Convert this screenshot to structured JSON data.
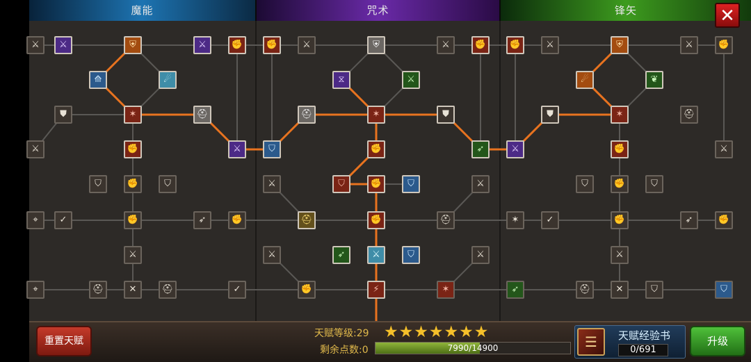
{
  "tabs": {
    "magic": "魔能",
    "curse": "咒术",
    "arrow": "锋矢"
  },
  "close_icon": "✕",
  "colors": {
    "active_link": "#e8731f",
    "inactive_link": "#5a5855",
    "panel_bg": "#2d2a27"
  },
  "grid": {
    "cols": [
      51,
      91,
      141,
      191,
      241,
      291,
      341,
      391,
      441,
      491,
      541,
      591,
      641,
      691,
      741,
      791,
      841,
      891,
      941,
      991,
      1041
    ],
    "rows": [
      65,
      115,
      165,
      215,
      265,
      317,
      367,
      417
    ]
  },
  "nodes": [
    {
      "c": 0,
      "r": 0,
      "g": "⚔",
      "t": "",
      "on": false
    },
    {
      "c": 1,
      "r": 0,
      "g": "⚔",
      "t": "purple",
      "on": true
    },
    {
      "c": 3,
      "r": 0,
      "g": "⛨",
      "t": "orange",
      "on": true
    },
    {
      "c": 5,
      "r": 0,
      "g": "⚔",
      "t": "purple",
      "on": true
    },
    {
      "c": 6,
      "r": 0,
      "g": "✊",
      "t": "red",
      "on": true
    },
    {
      "c": 7,
      "r": 0,
      "g": "✊",
      "t": "red",
      "on": true
    },
    {
      "c": 8,
      "r": 0,
      "g": "⚔",
      "t": "",
      "on": false
    },
    {
      "c": 10,
      "r": 0,
      "g": "⛨",
      "t": "gray",
      "on": true
    },
    {
      "c": 12,
      "r": 0,
      "g": "⚔",
      "t": "",
      "on": false
    },
    {
      "c": 13,
      "r": 0,
      "g": "✊",
      "t": "red",
      "on": true
    },
    {
      "c": 14,
      "r": 0,
      "g": "✊",
      "t": "red",
      "on": true
    },
    {
      "c": 15,
      "r": 0,
      "g": "⚔",
      "t": "",
      "on": false
    },
    {
      "c": 17,
      "r": 0,
      "g": "⛨",
      "t": "orange",
      "on": true
    },
    {
      "c": 19,
      "r": 0,
      "g": "⚔",
      "t": "",
      "on": false
    },
    {
      "c": 20,
      "r": 0,
      "g": "✊",
      "t": "",
      "on": false
    },
    {
      "c": 2,
      "r": 1,
      "g": "⟰",
      "t": "blue",
      "on": true
    },
    {
      "c": 4,
      "r": 1,
      "g": "☄",
      "t": "cyan",
      "on": true
    },
    {
      "c": 9,
      "r": 1,
      "g": "⧖",
      "t": "purple",
      "on": true
    },
    {
      "c": 11,
      "r": 1,
      "g": "⚔",
      "t": "green",
      "on": true
    },
    {
      "c": 16,
      "r": 1,
      "g": "☄",
      "t": "orange",
      "on": true
    },
    {
      "c": 18,
      "r": 1,
      "g": "❦",
      "t": "green",
      "on": true
    },
    {
      "c": 1,
      "r": 2,
      "g": "⛊",
      "t": "",
      "on": false
    },
    {
      "c": 3,
      "r": 2,
      "g": "✶",
      "t": "red",
      "on": true
    },
    {
      "c": 5,
      "r": 2,
      "g": "⛑",
      "t": "gray",
      "on": true
    },
    {
      "c": 8,
      "r": 2,
      "g": "⛑",
      "t": "gray",
      "on": true
    },
    {
      "c": 10,
      "r": 2,
      "g": "✶",
      "t": "red",
      "on": true
    },
    {
      "c": 12,
      "r": 2,
      "g": "⛊",
      "t": "",
      "on": true
    },
    {
      "c": 15,
      "r": 2,
      "g": "⛊",
      "t": "",
      "on": true
    },
    {
      "c": 17,
      "r": 2,
      "g": "✶",
      "t": "red",
      "on": true
    },
    {
      "c": 19,
      "r": 2,
      "g": "⛑",
      "t": "",
      "on": false
    },
    {
      "c": 0,
      "r": 3,
      "g": "⚔",
      "t": "",
      "on": false
    },
    {
      "c": 3,
      "r": 3,
      "g": "✊",
      "t": "red",
      "on": true
    },
    {
      "c": 6,
      "r": 3,
      "g": "⚔",
      "t": "purple",
      "on": true
    },
    {
      "c": 7,
      "r": 3,
      "g": "⛉",
      "t": "blue",
      "on": true
    },
    {
      "c": 10,
      "r": 3,
      "g": "✊",
      "t": "red",
      "on": true
    },
    {
      "c": 13,
      "r": 3,
      "g": "➶",
      "t": "green",
      "on": true
    },
    {
      "c": 14,
      "r": 3,
      "g": "⚔",
      "t": "purple",
      "on": true
    },
    {
      "c": 17,
      "r": 3,
      "g": "✊",
      "t": "red",
      "on": true
    },
    {
      "c": 20,
      "r": 3,
      "g": "⚔",
      "t": "",
      "on": false
    },
    {
      "c": 2,
      "r": 4,
      "g": "⛉",
      "t": "",
      "on": false
    },
    {
      "c": 3,
      "r": 4,
      "g": "✊",
      "t": "",
      "on": false
    },
    {
      "c": 4,
      "r": 4,
      "g": "⛉",
      "t": "",
      "on": false
    },
    {
      "c": 7,
      "r": 4,
      "g": "⚔",
      "t": "",
      "on": false
    },
    {
      "c": 9,
      "r": 4,
      "g": "⛉",
      "t": "red",
      "on": true
    },
    {
      "c": 10,
      "r": 4,
      "g": "✊",
      "t": "red",
      "on": true
    },
    {
      "c": 11,
      "r": 4,
      "g": "⛉",
      "t": "blue",
      "on": true
    },
    {
      "c": 13,
      "r": 4,
      "g": "⚔",
      "t": "",
      "on": false
    },
    {
      "c": 16,
      "r": 4,
      "g": "⛉",
      "t": "",
      "on": false
    },
    {
      "c": 17,
      "r": 4,
      "g": "✊",
      "t": "",
      "on": false
    },
    {
      "c": 18,
      "r": 4,
      "g": "⛉",
      "t": "",
      "on": false
    },
    {
      "c": 0,
      "r": 5,
      "g": "⌖",
      "t": "",
      "on": false
    },
    {
      "c": 1,
      "r": 5,
      "g": "✓",
      "t": "",
      "on": false
    },
    {
      "c": 3,
      "r": 5,
      "g": "✊",
      "t": "",
      "on": false
    },
    {
      "c": 5,
      "r": 5,
      "g": "➶",
      "t": "",
      "on": false
    },
    {
      "c": 6,
      "r": 5,
      "g": "✊",
      "t": "",
      "on": false
    },
    {
      "c": 8,
      "r": 5,
      "g": "⛑",
      "t": "gold",
      "on": true
    },
    {
      "c": 10,
      "r": 5,
      "g": "✊",
      "t": "red",
      "on": true
    },
    {
      "c": 12,
      "r": 5,
      "g": "⛑",
      "t": "",
      "on": false
    },
    {
      "c": 14,
      "r": 5,
      "g": "✶",
      "t": "",
      "on": false
    },
    {
      "c": 15,
      "r": 5,
      "g": "✓",
      "t": "",
      "on": false
    },
    {
      "c": 17,
      "r": 5,
      "g": "✊",
      "t": "",
      "on": false
    },
    {
      "c": 19,
      "r": 5,
      "g": "➶",
      "t": "",
      "on": false
    },
    {
      "c": 20,
      "r": 5,
      "g": "✊",
      "t": "",
      "on": false
    },
    {
      "c": 3,
      "r": 6,
      "g": "⚔",
      "t": "",
      "on": false
    },
    {
      "c": 7,
      "r": 6,
      "g": "⚔",
      "t": "",
      "on": false
    },
    {
      "c": 9,
      "r": 6,
      "g": "➶",
      "t": "green",
      "on": true
    },
    {
      "c": 10,
      "r": 6,
      "g": "⚔",
      "t": "cyan",
      "on": true
    },
    {
      "c": 11,
      "r": 6,
      "g": "⛉",
      "t": "blue",
      "on": true
    },
    {
      "c": 13,
      "r": 6,
      "g": "⚔",
      "t": "",
      "on": false
    },
    {
      "c": 17,
      "r": 6,
      "g": "⚔",
      "t": "",
      "on": false
    },
    {
      "c": 0,
      "r": 7,
      "g": "⌖",
      "t": "",
      "on": false
    },
    {
      "c": 2,
      "r": 7,
      "g": "⛑",
      "t": "",
      "on": false
    },
    {
      "c": 3,
      "r": 7,
      "g": "✕",
      "t": "",
      "on": false
    },
    {
      "c": 4,
      "r": 7,
      "g": "⛑",
      "t": "",
      "on": false
    },
    {
      "c": 6,
      "r": 7,
      "g": "✓",
      "t": "",
      "on": false
    },
    {
      "c": 8,
      "r": 7,
      "g": "✊",
      "t": "",
      "on": false
    },
    {
      "c": 10,
      "r": 7,
      "g": "⚡",
      "t": "red",
      "on": true
    },
    {
      "c": 12,
      "r": 7,
      "g": "✶",
      "t": "red",
      "on": false
    },
    {
      "c": 14,
      "r": 7,
      "g": "➶",
      "t": "green",
      "on": false
    },
    {
      "c": 16,
      "r": 7,
      "g": "⛑",
      "t": "",
      "on": false
    },
    {
      "c": 17,
      "r": 7,
      "g": "✕",
      "t": "",
      "on": false
    },
    {
      "c": 18,
      "r": 7,
      "g": "⛉",
      "t": "",
      "on": false
    },
    {
      "c": 20,
      "r": 7,
      "g": "⛉",
      "t": "blue",
      "on": false
    }
  ],
  "links": [
    {
      "a": [
        3,
        0
      ],
      "b": [
        2,
        1
      ],
      "on": true
    },
    {
      "a": [
        3,
        0
      ],
      "b": [
        4,
        1
      ],
      "on": false
    },
    {
      "a": [
        2,
        1
      ],
      "b": [
        3,
        2
      ],
      "on": true
    },
    {
      "a": [
        4,
        1
      ],
      "b": [
        3,
        2
      ],
      "on": false
    },
    {
      "a": [
        3,
        2
      ],
      "b": [
        5,
        2
      ],
      "on": true
    },
    {
      "a": [
        5,
        2
      ],
      "b": [
        6,
        3
      ],
      "on": true
    },
    {
      "a": [
        1,
        2
      ],
      "b": [
        3,
        2
      ],
      "on": false
    },
    {
      "a": [
        3,
        2
      ],
      "b": [
        3,
        3
      ],
      "on": false
    },
    {
      "a": [
        6,
        3
      ],
      "b": [
        7,
        3
      ],
      "on": true
    },
    {
      "a": [
        7,
        3
      ],
      "b": [
        8,
        2
      ],
      "on": true
    },
    {
      "a": [
        8,
        2
      ],
      "b": [
        10,
        2
      ],
      "on": true
    },
    {
      "a": [
        10,
        0
      ],
      "b": [
        9,
        1
      ],
      "on": false
    },
    {
      "a": [
        10,
        0
      ],
      "b": [
        11,
        1
      ],
      "on": false
    },
    {
      "a": [
        9,
        1
      ],
      "b": [
        10,
        2
      ],
      "on": true
    },
    {
      "a": [
        11,
        1
      ],
      "b": [
        10,
        2
      ],
      "on": false
    },
    {
      "a": [
        10,
        2
      ],
      "b": [
        12,
        2
      ],
      "on": true
    },
    {
      "a": [
        12,
        2
      ],
      "b": [
        13,
        3
      ],
      "on": true
    },
    {
      "a": [
        13,
        3
      ],
      "b": [
        14,
        3
      ],
      "on": true
    },
    {
      "a": [
        14,
        3
      ],
      "b": [
        15,
        2
      ],
      "on": true
    },
    {
      "a": [
        15,
        2
      ],
      "b": [
        17,
        2
      ],
      "on": true
    },
    {
      "a": [
        17,
        0
      ],
      "b": [
        16,
        1
      ],
      "on": true
    },
    {
      "a": [
        17,
        0
      ],
      "b": [
        18,
        1
      ],
      "on": false
    },
    {
      "a": [
        16,
        1
      ],
      "b": [
        17,
        2
      ],
      "on": true
    },
    {
      "a": [
        18,
        1
      ],
      "b": [
        17,
        2
      ],
      "on": false
    },
    {
      "a": [
        10,
        2
      ],
      "b": [
        10,
        3
      ],
      "on": true
    },
    {
      "a": [
        10,
        3
      ],
      "b": [
        9,
        4
      ],
      "on": true
    },
    {
      "a": [
        9,
        4
      ],
      "b": [
        10,
        4
      ],
      "on": true
    },
    {
      "a": [
        10,
        4
      ],
      "b": [
        11,
        4
      ],
      "on": false
    },
    {
      "a": [
        10,
        4
      ],
      "b": [
        10,
        5
      ],
      "on": true
    },
    {
      "a": [
        10,
        5
      ],
      "b": [
        10,
        6
      ],
      "on": true
    },
    {
      "a": [
        10,
        6
      ],
      "b": [
        10,
        7
      ],
      "on": true
    },
    {
      "a": [
        10,
        7
      ],
      "b": [
        10,
        8
      ],
      "on": true
    },
    {
      "a": [
        3,
        3
      ],
      "b": [
        3,
        4
      ],
      "on": false
    },
    {
      "a": [
        3,
        4
      ],
      "b": [
        3,
        5
      ],
      "on": false
    },
    {
      "a": [
        3,
        5
      ],
      "b": [
        3,
        6
      ],
      "on": false
    },
    {
      "a": [
        3,
        6
      ],
      "b": [
        3,
        7
      ],
      "on": false
    },
    {
      "a": [
        17,
        2
      ],
      "b": [
        17,
        3
      ],
      "on": false
    },
    {
      "a": [
        17,
        3
      ],
      "b": [
        17,
        4
      ],
      "on": false
    },
    {
      "a": [
        17,
        4
      ],
      "b": [
        17,
        5
      ],
      "on": false
    },
    {
      "a": [
        17,
        5
      ],
      "b": [
        17,
        6
      ],
      "on": false
    },
    {
      "a": [
        17,
        6
      ],
      "b": [
        17,
        7
      ],
      "on": false
    },
    {
      "a": [
        0,
        0
      ],
      "b": [
        20,
        0
      ],
      "on": false
    },
    {
      "a": [
        0,
        5
      ],
      "b": [
        20,
        5
      ],
      "on": false
    },
    {
      "a": [
        0,
        7
      ],
      "b": [
        20,
        7
      ],
      "on": false
    },
    {
      "a": [
        6,
        0
      ],
      "b": [
        6,
        3
      ],
      "on": false
    },
    {
      "a": [
        7,
        0
      ],
      "b": [
        7,
        3
      ],
      "on": false
    },
    {
      "a": [
        13,
        0
      ],
      "b": [
        13,
        3
      ],
      "on": false
    },
    {
      "a": [
        14,
        0
      ],
      "b": [
        14,
        3
      ],
      "on": false
    },
    {
      "a": [
        20,
        0
      ],
      "b": [
        20,
        3
      ],
      "on": false
    },
    {
      "a": [
        1,
        2
      ],
      "b": [
        0,
        3
      ],
      "on": false
    },
    {
      "a": [
        7,
        4
      ],
      "b": [
        8,
        5
      ],
      "on": false
    },
    {
      "a": [
        13,
        4
      ],
      "b": [
        12,
        5
      ],
      "on": false
    },
    {
      "a": [
        7,
        6
      ],
      "b": [
        8,
        7
      ],
      "on": false
    },
    {
      "a": [
        13,
        6
      ],
      "b": [
        12,
        7
      ],
      "on": false
    }
  ],
  "bottom": {
    "reset_label": "重置天赋",
    "talent_level_label": "天赋等级:29",
    "stars_count": 7,
    "star_glyph": "★",
    "points_label": "剩余点数:0",
    "exp_current": 7990,
    "exp_max": 14900,
    "exp_text": "7990/14900",
    "book_title": "天赋经验书",
    "book_count": "0/691",
    "book_icon": "book-icon",
    "upgrade_label": "升级"
  }
}
